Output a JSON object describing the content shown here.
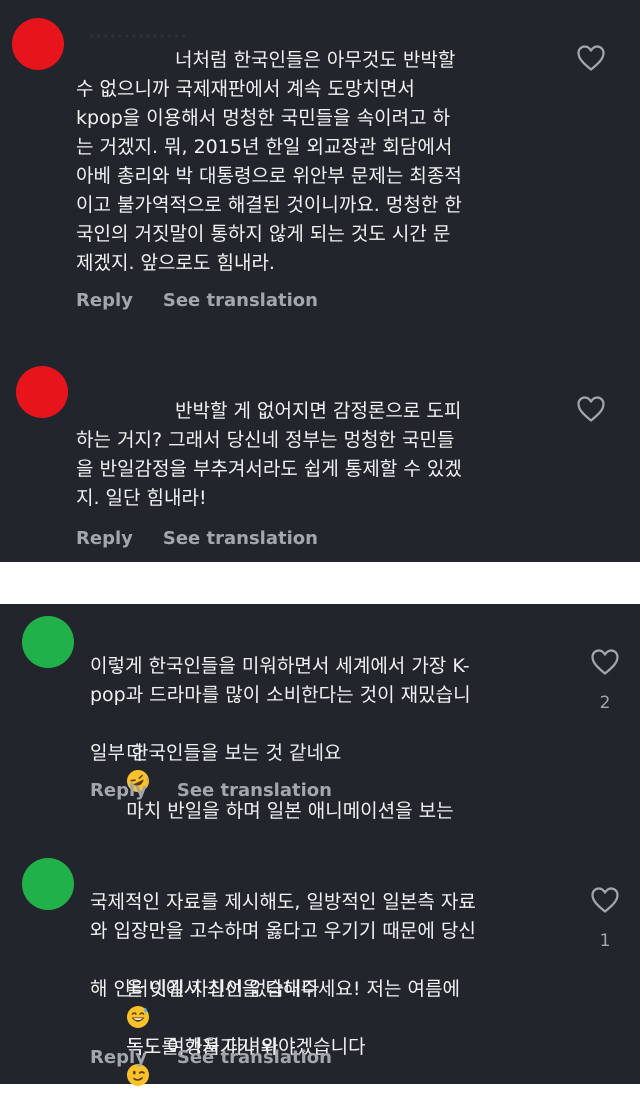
{
  "colors": {
    "panel_bg": "#23252c",
    "text": "#f1f1f1",
    "muted": "#a4a6ad",
    "avatar_red": "#e8141c",
    "avatar_green": "#21b14a",
    "divider": "#ffffff"
  },
  "labels": {
    "reply": "Reply",
    "translate": "See translation"
  },
  "comments": [
    {
      "avatar_color": "red",
      "text_lines": [
        "너처럼 한국인들은 아무것도 반박할",
        "수 없으니까 국제재판에서 계속 도망치면서",
        "kpop을 이용해서 멍청한 국민들을 속이려고 하",
        "는 거겠지. 뭐, 2015년 한일 외교장관 회담에서",
        "아베 총리와 박 대통령으로 위안부 문제는 최종적",
        "이고 불가역적으로 해결된 것이니까요. 멍청한 한",
        "국인의 거짓말이 통하지 않게 되는 것도 시간 문",
        "제겠지. 앞으로도 힘내라."
      ],
      "likes": ""
    },
    {
      "avatar_color": "red",
      "text_lines": [
        "반박할 게 없어지면 감정론으로 도피",
        "하는 거지? 그래서 당신네 정부는 멍청한 국민들",
        "을 반일감정을 부추겨서라도 쉽게 통제할 수 있겠",
        "지. 일단 힘내라!"
      ],
      "likes": ""
    },
    {
      "avatar_color": "green",
      "text_lines": [
        "이렇게 한국인들을 미워하면서 세계에서 가장 K-",
        "pop과 드라마를 많이 소비한다는 것이 재밌습니",
        "다",
        "마치 반일을 하며 일본 애니메이션을 보는",
        "일부 한국인들을 보는 것 같네요"
      ],
      "emoji": "rolling-on-floor-laughing-emoji",
      "likes": "2"
    },
    {
      "avatar_color": "green",
      "text_lines": [
        "국제적인 자료를 제시해도, 일방적인 일본측 자료",
        "와 입장만을 고수하며 옳다고 우기기 때문에 당신",
        "을 이길 자신이 없습니다",
        "독도를 가져가기 위",
        "해 인터넷에서 최선을 다해주세요! 저는 여름에",
        "독도 여행을 다녀와야겠습니다"
      ],
      "emoji": "grinning-sweat-emoji",
      "emoji2": "winking-face-emoji",
      "likes": "1"
    }
  ]
}
